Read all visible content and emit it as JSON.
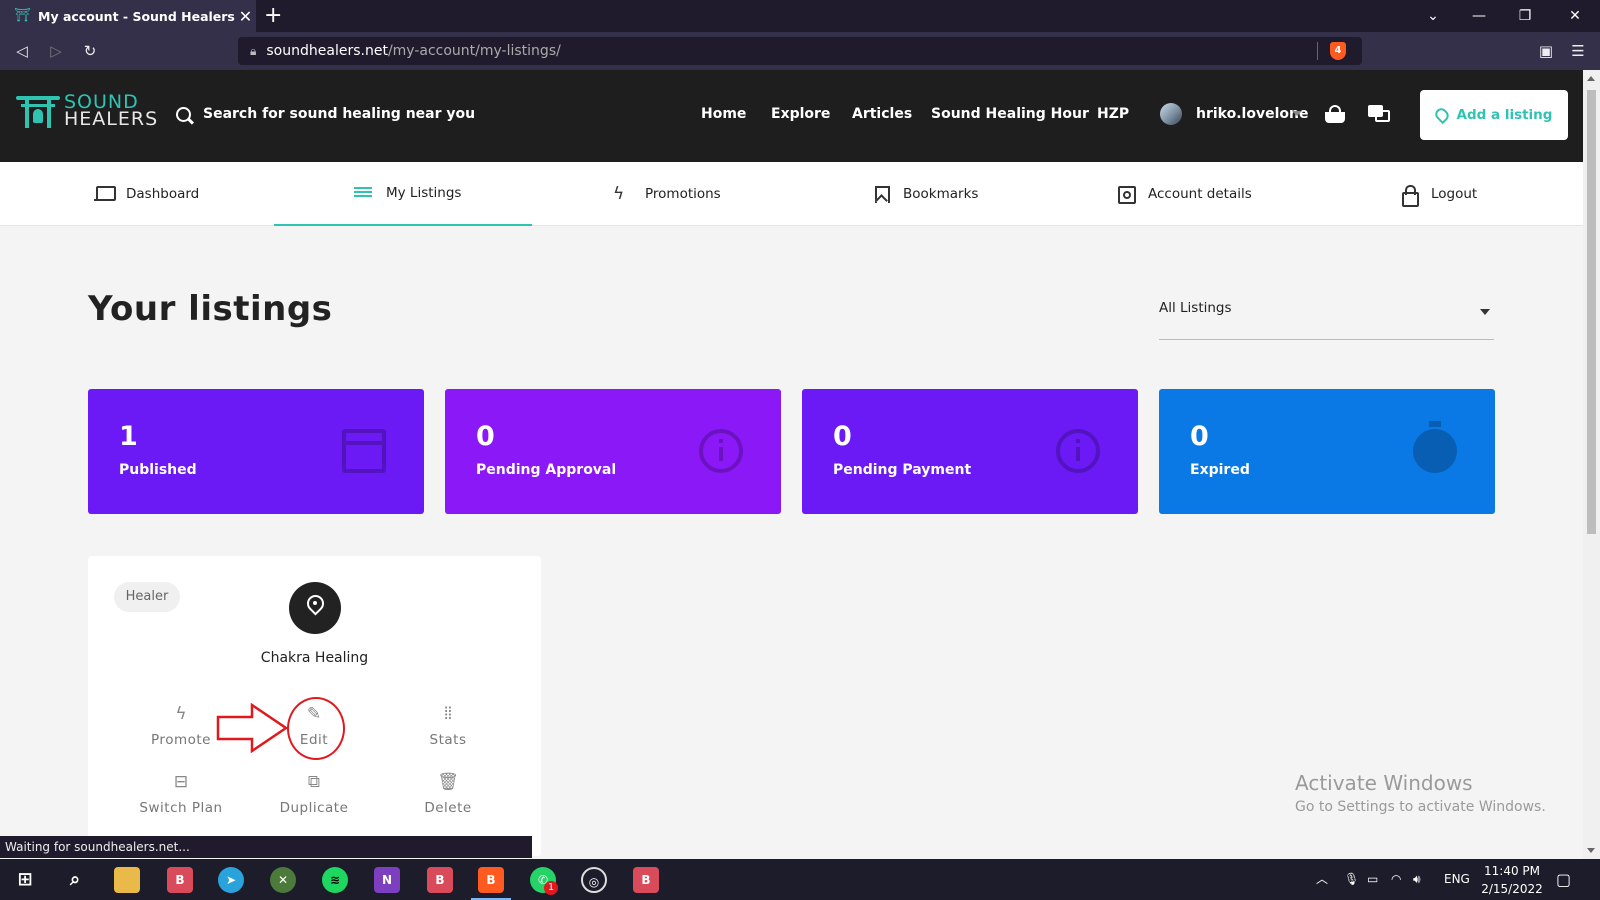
{
  "browser": {
    "tab_title": "My account - Sound Healers",
    "url_host": "soundhealers.net",
    "url_path": "/my-account/my-listings/",
    "shield_count": "4",
    "status_text": "Waiting for soundhealers.net..."
  },
  "site": {
    "logo_top": "SOUND",
    "logo_bottom": "HEALERS",
    "search_placeholder": "Search for sound healing near you",
    "nav": [
      "Home",
      "Explore",
      "Articles",
      "Sound Healing Hour",
      "HZP"
    ],
    "username": "hriko.lovelone",
    "add_listing": "Add a listing"
  },
  "account_tabs": [
    {
      "label": "Dashboard",
      "icon": "laptop-icon"
    },
    {
      "label": "My Listings",
      "icon": "list-icon",
      "active": true
    },
    {
      "label": "Promotions",
      "icon": "bolt-icon"
    },
    {
      "label": "Bookmarks",
      "icon": "bookmark-icon"
    },
    {
      "label": "Account details",
      "icon": "settings-icon"
    },
    {
      "label": "Logout",
      "icon": "lock-icon"
    }
  ],
  "main": {
    "title": "Your listings",
    "filter_value": "All Listings"
  },
  "stats": [
    {
      "count": "1",
      "label": "Published",
      "color": "#6b19f5",
      "icon": "window-icon"
    },
    {
      "count": "0",
      "label": "Pending Approval",
      "color": "#8b18f7",
      "icon": "info-icon"
    },
    {
      "count": "0",
      "label": "Pending Payment",
      "color": "#6b19f5",
      "icon": "info-icon"
    },
    {
      "count": "0",
      "label": "Expired",
      "color": "#0a79e6",
      "icon": "timer-icon"
    }
  ],
  "listing": {
    "category": "Healer",
    "title": "Chakra Healing",
    "actions": {
      "promote": "Promote",
      "edit": "Edit",
      "stats": "Stats",
      "switch_plan": "Switch Plan",
      "duplicate": "Duplicate",
      "delete": "Delete"
    }
  },
  "watermark": {
    "line1": "Activate Windows",
    "line2": "Go to Settings to activate Windows."
  },
  "taskbar": {
    "lang": "ENG",
    "time": "11:40 PM",
    "date": "2/15/2022",
    "whatsapp_badge": "1"
  },
  "colors": {
    "accent": "#2fc4b2",
    "annotation": "#e0191e"
  }
}
